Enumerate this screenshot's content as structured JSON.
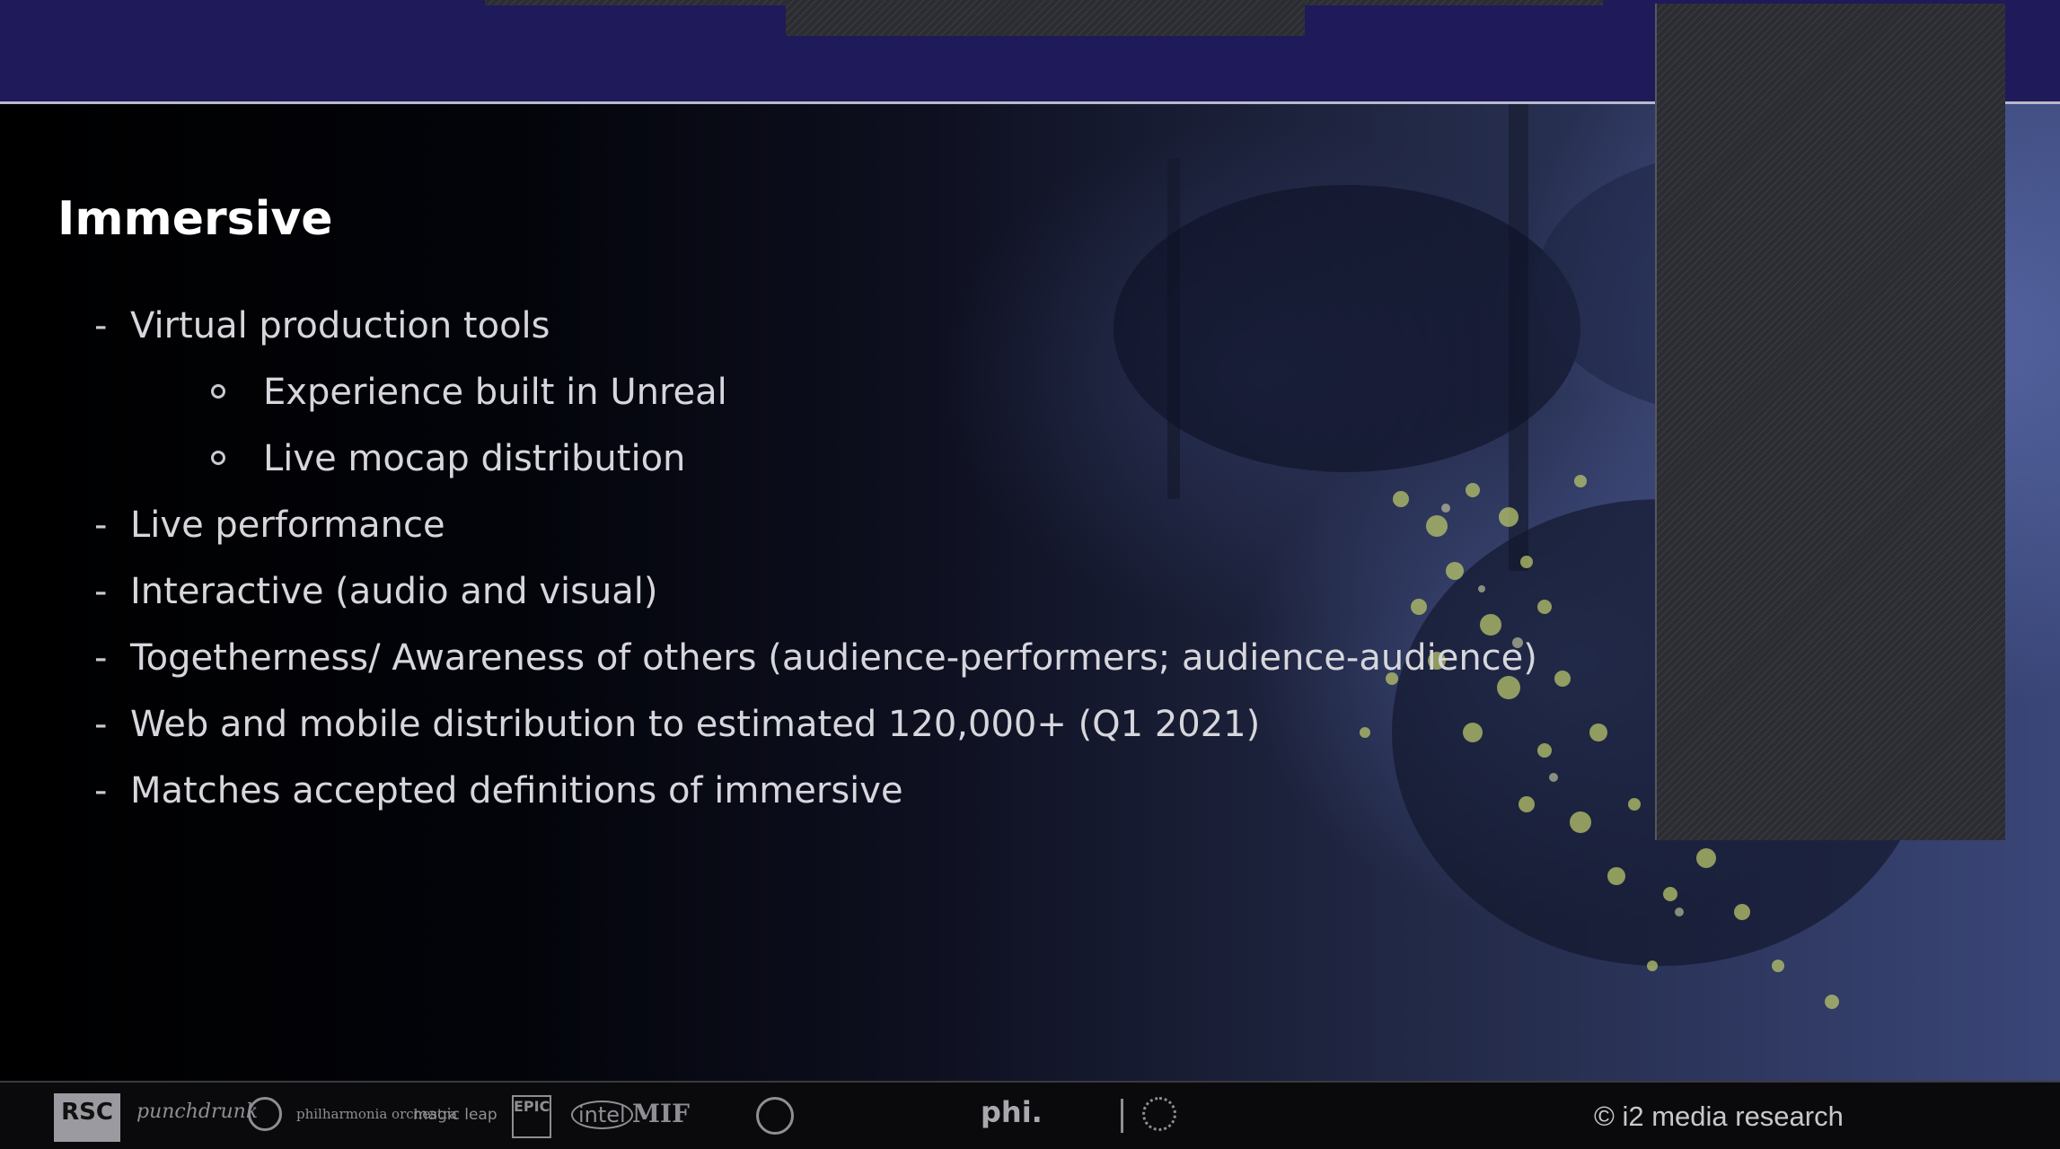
{
  "slide": {
    "title": "Immersive",
    "bullets": [
      {
        "level": 1,
        "marker": "-",
        "text": "Virtual production tools"
      },
      {
        "level": 2,
        "marker": "o",
        "text": "Experience built in Unreal"
      },
      {
        "level": 2,
        "marker": "o",
        "text": "Live mocap distribution"
      },
      {
        "level": 1,
        "marker": "-",
        "text": "Live performance"
      },
      {
        "level": 1,
        "marker": "-",
        "text": "Interactive (audio and visual)"
      },
      {
        "level": 1,
        "marker": "-",
        "text": "Togetherness/ Awareness of others (audience-performers; audience-audience)"
      },
      {
        "level": 1,
        "marker": "-",
        "text": "Web and mobile distribution to estimated 120,000+ (Q1 2021)"
      },
      {
        "level": 1,
        "marker": "-",
        "text": "Matches accepted definitions of immersive"
      }
    ]
  },
  "footer": {
    "logos": {
      "rsc": "RSC",
      "punchdrunk": "punchdrunk",
      "philharmonia": "philharmonia orchestra",
      "magic_leap": "magic leap",
      "epic": "EPIC",
      "intel": "intel",
      "mif": "MIF",
      "phi": "phi."
    },
    "copyright": "© i2 media research"
  },
  "colors": {
    "top_band": "#1f1a5a",
    "title_text": "#ffffff",
    "bullet_text": "#d6d6dc",
    "footer_bg": "#0a0a0c"
  }
}
